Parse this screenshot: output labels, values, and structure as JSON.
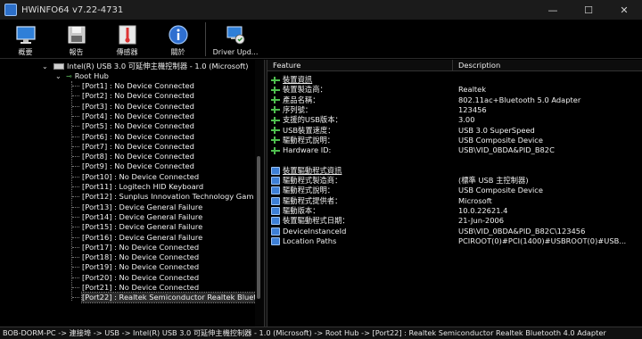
{
  "window": {
    "title": "HWiNFO64 v7.22-4731",
    "controls": {
      "minimize": "—",
      "maximize": "☐",
      "close": "✕"
    }
  },
  "toolbar": {
    "buttons": [
      {
        "label": "概要",
        "icon": "monitor-icon"
      },
      {
        "label": "報告",
        "icon": "floppy-save-icon"
      },
      {
        "label": "傳感器",
        "icon": "thermometer-icon"
      },
      {
        "label": "關於",
        "icon": "info-icon"
      },
      {
        "label": "Driver Upd...",
        "icon": "driver-update-icon"
      }
    ]
  },
  "tree": {
    "controller": "Intel(R) USB 3.0 可延伸主機控制器 - 1.0 (Microsoft)",
    "hub": "Root Hub",
    "ports": [
      "[Port1] : No Device Connected",
      "[Port2] : No Device Connected",
      "[Port3] : No Device Connected",
      "[Port4] : No Device Connected",
      "[Port5] : No Device Connected",
      "[Port6] : No Device Connected",
      "[Port7] : No Device Connected",
      "[Port8] : No Device Connected",
      "[Port9] : No Device Connected",
      "[Port10] : No Device Connected",
      "[Port11] : Logitech HID Keyboard",
      "[Port12] : Sunplus Innovation Technology Gam",
      "[Port13] : Device General Failure",
      "[Port14] : Device General Failure",
      "[Port15] : Device General Failure",
      "[Port16] : Device General Failure",
      "[Port17] : No Device Connected",
      "[Port18] : No Device Connected",
      "[Port19] : No Device Connected",
      "[Port20] : No Device Connected",
      "[Port21] : No Device Connected",
      "[Port22] : Realtek Semiconductor Realtek Blueto"
    ],
    "selected_index": 21
  },
  "props": {
    "headers": {
      "feature": "Feature",
      "description": "Description"
    },
    "rows": [
      {
        "feature": "裝置資訊",
        "value": "",
        "section": true,
        "icon": "usb-green-icon"
      },
      {
        "feature": "裝置製造商：",
        "value": "Realtek",
        "icon": "usb-green-icon"
      },
      {
        "feature": "產品名稱：",
        "value": "802.11ac+Bluetooth 5.0 Adapter",
        "icon": "usb-green-icon"
      },
      {
        "feature": "序列號：",
        "value": "123456",
        "icon": "usb-green-icon"
      },
      {
        "feature": "支援的USB版本：",
        "value": "3.00",
        "icon": "usb-green-icon"
      },
      {
        "feature": "USB裝置速度：",
        "value": "USB 3.0 SuperSpeed",
        "icon": "usb-green-icon"
      },
      {
        "feature": "驅動程式說明：",
        "value": "USB Composite Device",
        "icon": "usb-green-icon"
      },
      {
        "feature": "Hardware ID:",
        "value": "USB\\VID_0BDA&PID_B82C",
        "icon": "usb-green-icon"
      },
      {
        "feature": "",
        "value": "",
        "icon": ""
      },
      {
        "feature": "裝置驅動程式資訊",
        "value": "",
        "section": true,
        "icon": "driver-blue-icon"
      },
      {
        "feature": "驅動程式製造商：",
        "value": "(標準 USB 主控制器)",
        "icon": "driver-blue-icon"
      },
      {
        "feature": "驅動程式說明：",
        "value": "USB Composite Device",
        "icon": "driver-blue-icon"
      },
      {
        "feature": "驅動程式提供者：",
        "value": "Microsoft",
        "icon": "driver-blue-icon"
      },
      {
        "feature": "驅動版本：",
        "value": "10.0.22621.4",
        "icon": "driver-blue-icon"
      },
      {
        "feature": "裝置驅動程式日期：",
        "value": "21-Jun-2006",
        "icon": "driver-blue-icon"
      },
      {
        "feature": "DeviceInstanceId",
        "value": "USB\\VID_0BDA&PID_B82C\\123456",
        "icon": "driver-blue-icon"
      },
      {
        "feature": "Location Paths",
        "value": "PCIROOT(0)#PCI(1400)#USBROOT(0)#USB...",
        "icon": "driver-blue-icon"
      }
    ]
  },
  "statusbar": {
    "text": "BOB-DORM-PC -> 連接埠 -> USB -> Intel(R) USB 3.0 可延伸主機控制器 - 1.0 (Microsoft) -> Root Hub -> [Port22] : Realtek Semiconductor Realtek Bluetooth 4.0 Adapter"
  }
}
